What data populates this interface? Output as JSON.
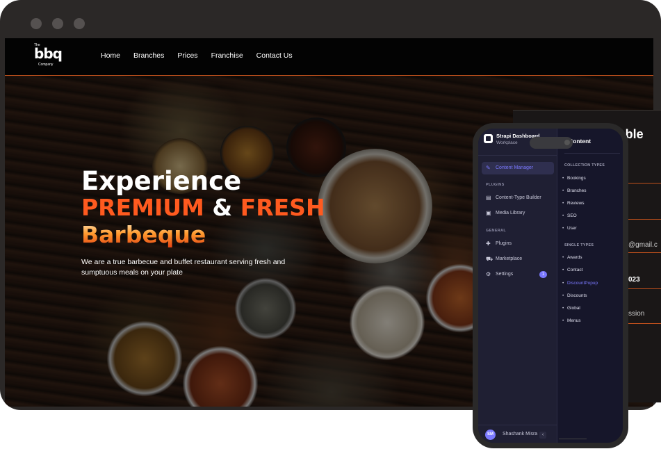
{
  "site": {
    "logo": {
      "top": "The",
      "mark": "bbq",
      "bottom": "Company"
    },
    "nav": [
      "Home",
      "Branches",
      "Prices",
      "Franchise",
      "Contact Us"
    ],
    "hero": {
      "line1": "Experience",
      "premium": "PREMIUM",
      "amp": "&",
      "fresh": "FRESH",
      "line3": "Barbeque",
      "subtitle": "We are a true barbecue and buffet restaurant serving fresh and sumptuous meals on your plate"
    },
    "booking_panel": {
      "title": "Table",
      "email_partial": "@gmail.c",
      "year_partial": "023",
      "session_partial": "ssion"
    }
  },
  "dashboard": {
    "title": "Strapi Dashboard",
    "workplace": "Workplace",
    "active_item": "Content Manager",
    "plugins_section": "PLUGINS",
    "plugins": [
      "Content-Type Builder",
      "Media Library"
    ],
    "general_section": "GENERAL",
    "general": [
      "Plugins",
      "Marketplace",
      "Settings"
    ],
    "settings_badge": "1",
    "user_initials": "SM",
    "user_name": "Shashank Misra",
    "collapse_icon": "‹",
    "content_title": "Content",
    "collection_section": "COLLECTION TYPES",
    "collection_types": [
      "Bookings",
      "Branches",
      "Reviews",
      "SEO",
      "User"
    ],
    "single_section": "SINGLE TYPES",
    "single_types": [
      "Awards",
      "Contact",
      "DiscountPopup",
      "Discounts",
      "Global",
      "Menus"
    ],
    "selected_single_type": "DiscountPopup"
  },
  "colors": {
    "accent_orange": "#ff5a1f",
    "strapi_purple": "#7b79ff",
    "whatsapp_green": "#25d366"
  },
  "icons": {
    "content_manager": "feather-icon",
    "content_type_builder": "layout-icon",
    "media_library": "image-icon",
    "plugins": "puzzle-icon",
    "marketplace": "cart-icon",
    "settings": "gear-icon",
    "whatsapp": "whatsapp-icon"
  }
}
